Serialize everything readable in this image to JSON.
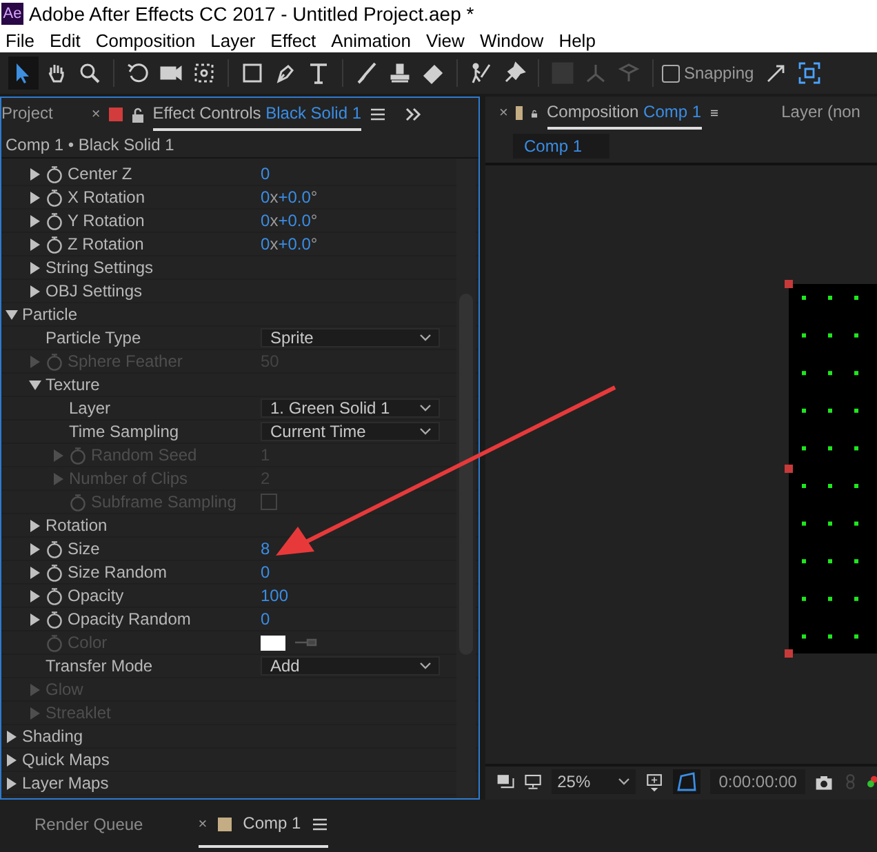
{
  "window": {
    "app_icon": "Ae",
    "title": "Adobe After Effects CC 2017 - Untitled Project.aep *"
  },
  "menu": [
    "File",
    "Edit",
    "Composition",
    "Layer",
    "Effect",
    "Animation",
    "View",
    "Window",
    "Help"
  ],
  "toolbar": {
    "tools": [
      {
        "kind": "selection",
        "selected": true,
        "disabled": false
      },
      {
        "kind": "hand",
        "selected": false,
        "disabled": false
      },
      {
        "kind": "zoom",
        "selected": false,
        "disabled": false
      },
      {
        "kind": "rotate",
        "selected": false,
        "disabled": false
      },
      {
        "kind": "camera",
        "selected": false,
        "disabled": false
      },
      {
        "kind": "pan",
        "selected": false,
        "disabled": false
      },
      {
        "kind": "rectangle",
        "selected": false,
        "disabled": false
      },
      {
        "kind": "pen",
        "selected": false,
        "disabled": false
      },
      {
        "kind": "type",
        "selected": false,
        "disabled": false
      },
      {
        "kind": "brush",
        "selected": false,
        "disabled": false
      },
      {
        "kind": "stamp",
        "selected": false,
        "disabled": false
      },
      {
        "kind": "eraser",
        "selected": false,
        "disabled": false
      },
      {
        "kind": "roto",
        "selected": false,
        "disabled": false
      },
      {
        "kind": "pin",
        "selected": false,
        "disabled": false
      },
      {
        "kind": "local-axis",
        "selected": false,
        "disabled": true
      },
      {
        "kind": "world-axis",
        "selected": false,
        "disabled": true
      },
      {
        "kind": "view-axis",
        "selected": false,
        "disabled": true
      }
    ],
    "snapping": {
      "label": "Snapping",
      "checked": false
    }
  },
  "left_panel": {
    "tabs": [
      {
        "label": "Project",
        "selected": false
      },
      {
        "label": "Effect Controls",
        "target": "Black Solid 1",
        "close": "×",
        "color": "#d23c3c",
        "selected": true
      }
    ],
    "breadcrumb": "Comp 1 • Black Solid 1",
    "properties": [
      {
        "children": [
          {
            "label": "Center Z",
            "expanded": false,
            "stopwatch": true,
            "disabled": false,
            "value": {
              "kind": "number",
              "text": "0"
            }
          },
          {
            "label": "X Rotation",
            "expanded": false,
            "stopwatch": true,
            "disabled": false,
            "value": {
              "kind": "angle",
              "turns": "0",
              "unit": "x",
              "degrees": "+0.0",
              "degree_sign": "°"
            }
          },
          {
            "label": "Y Rotation",
            "expanded": false,
            "stopwatch": true,
            "disabled": false,
            "value": {
              "kind": "angle",
              "turns": "0",
              "unit": "x",
              "degrees": "+0.0",
              "degree_sign": "°"
            }
          },
          {
            "label": "Z Rotation",
            "expanded": false,
            "stopwatch": true,
            "disabled": false,
            "value": {
              "kind": "angle",
              "turns": "0",
              "unit": "x",
              "degrees": "+0.0",
              "degree_sign": "°"
            }
          },
          {
            "label": "String Settings",
            "expanded": false,
            "stopwatch": false,
            "disabled": false
          },
          {
            "label": "OBJ Settings",
            "expanded": false,
            "stopwatch": false,
            "disabled": false
          }
        ]
      },
      {
        "label": "Particle",
        "expanded": true,
        "stopwatch": false,
        "disabled": false,
        "children": [
          {
            "label": "Particle Type",
            "stopwatch": false,
            "disabled": false,
            "value": {
              "kind": "dropdown",
              "text": "Sprite"
            }
          },
          {
            "label": "Sphere Feather",
            "expanded": false,
            "stopwatch": true,
            "disabled": true,
            "value": {
              "kind": "number",
              "text": "50"
            }
          },
          {
            "label": "Texture",
            "expanded": true,
            "stopwatch": false,
            "disabled": false,
            "children": [
              {
                "label": "Layer",
                "stopwatch": false,
                "disabled": false,
                "value": {
                  "kind": "dropdown",
                  "text": "1. Green Solid 1"
                }
              },
              {
                "label": "Time Sampling",
                "stopwatch": false,
                "disabled": false,
                "value": {
                  "kind": "dropdown",
                  "text": "Current Time"
                }
              },
              {
                "label": "Random Seed",
                "expanded": false,
                "stopwatch": true,
                "disabled": true,
                "value": {
                  "kind": "number",
                  "text": "1"
                }
              },
              {
                "label": "Number of Clips",
                "expanded": false,
                "stopwatch": false,
                "disabled": true,
                "value": {
                  "kind": "number",
                  "text": "2"
                }
              },
              {
                "label": "Subframe Sampling",
                "stopwatch": true,
                "disabled": true,
                "value": {
                  "kind": "checkbox",
                  "checked": false
                }
              }
            ]
          },
          {
            "label": "Rotation",
            "expanded": false,
            "stopwatch": false,
            "disabled": false
          },
          {
            "label": "Size",
            "expanded": false,
            "stopwatch": true,
            "disabled": false,
            "value": {
              "kind": "number",
              "text": "8"
            }
          },
          {
            "label": "Size Random",
            "expanded": false,
            "stopwatch": true,
            "disabled": false,
            "value": {
              "kind": "number",
              "text": "0"
            }
          },
          {
            "label": "Opacity",
            "expanded": false,
            "stopwatch": true,
            "disabled": false,
            "value": {
              "kind": "number",
              "text": "100"
            }
          },
          {
            "label": "Opacity Random",
            "expanded": false,
            "stopwatch": true,
            "disabled": false,
            "value": {
              "kind": "number",
              "text": "0"
            }
          },
          {
            "label": "Color",
            "stopwatch": true,
            "disabled": true,
            "value": {
              "kind": "color",
              "color": "#ffffff"
            }
          },
          {
            "label": "Transfer Mode",
            "stopwatch": false,
            "disabled": false,
            "value": {
              "kind": "dropdown",
              "text": "Add"
            }
          },
          {
            "label": "Glow",
            "expanded": false,
            "stopwatch": false,
            "disabled": true
          },
          {
            "label": "Streaklet",
            "expanded": false,
            "stopwatch": false,
            "disabled": true
          }
        ]
      },
      {
        "label": "Shading",
        "expanded": false,
        "stopwatch": false,
        "disabled": false
      },
      {
        "label": "Quick Maps",
        "expanded": false,
        "stopwatch": false,
        "disabled": false
      },
      {
        "label": "Layer Maps",
        "expanded": false,
        "stopwatch": false,
        "disabled": false
      }
    ]
  },
  "composition_panel": {
    "tabs": [
      {
        "label": "Composition",
        "target": "Comp 1",
        "close": "×",
        "color": "#c4ad84",
        "selected": true
      },
      {
        "label": "Layer (non",
        "selected": false
      }
    ],
    "comp_tab": "Comp 1",
    "viewer": {
      "zoom": "25%",
      "timecode": "0:00:00:00",
      "mask_view": true
    }
  },
  "bottom_panel": {
    "tabs": [
      {
        "label": "Render Queue",
        "selected": false
      },
      {
        "label": "Comp 1",
        "close": "×",
        "color": "#c4ad84",
        "selected": true
      }
    ]
  }
}
